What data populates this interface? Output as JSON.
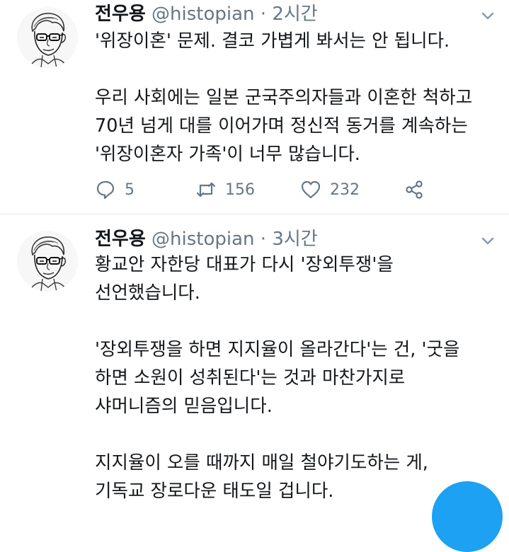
{
  "tweets": [
    {
      "name": "전우용",
      "handle": "@histopian",
      "separator": "·",
      "time": "2시간",
      "lines": [
        "'위장이혼' 문제. 결코 가볍게 봐서는 안 됩니다.",
        "",
        "우리 사회에는 일본 군국주의자들과 이혼한 척하고",
        "70년 넘게 대를 이어가며 정신적 동거를 계속하는",
        "'위장이혼자 가족'이 너무 많습니다."
      ],
      "replies": "5",
      "retweets": "156",
      "likes": "232"
    },
    {
      "name": "전우용",
      "handle": "@histopian",
      "separator": "·",
      "time": "3시간",
      "lines": [
        "황교안 자한당 대표가 다시 '장외투쟁'을",
        "선언했습니다.",
        "",
        "'장외투쟁을 하면 지지율이 올라간다'는 건, '굿을",
        "하면 소원이 성취된다'는 것과 마찬가지로",
        "샤머니즘의 믿음입니다.",
        "",
        "지지율이 오를 때까지 매일 철야기도하는 게,",
        "기독교 장로다운 태도일 겁니다."
      ]
    }
  ],
  "icons": {
    "avatar": "line-drawing-portrait",
    "caret": "chevron-down-icon",
    "reply": "speech-bubble-icon",
    "retweet": "retweet-icon",
    "like": "heart-icon",
    "share": "share-icon"
  },
  "colors": {
    "text": "#14171a",
    "muted": "#657786",
    "divider": "#e1e8ed",
    "accent": "#1da1f2"
  }
}
